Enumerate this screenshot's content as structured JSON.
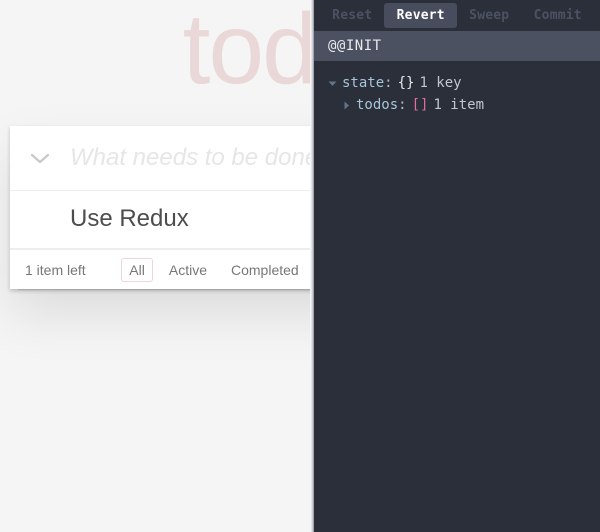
{
  "app": {
    "title": "todos",
    "toggle_all_icon": "chevron-down-icon",
    "new_todo": {
      "value": "",
      "placeholder": "What needs to be done?"
    },
    "items": [
      {
        "label": "Use Redux",
        "completed": false
      }
    ],
    "footer": {
      "count_text": "1 item left",
      "filters": [
        {
          "label": "All",
          "selected": true
        },
        {
          "label": "Active",
          "selected": false
        },
        {
          "label": "Completed",
          "selected": false
        }
      ]
    },
    "colors": {
      "title": "#af2f2f",
      "background": "#f5f5f5",
      "card": "#ffffff",
      "text": "#4d4d4d",
      "placeholder": "#e6e6e6",
      "filter_border": "rgba(175,47,47,0.2)"
    }
  },
  "devtools": {
    "toolbar": {
      "buttons": [
        {
          "label": "Reset",
          "active": false
        },
        {
          "label": "Revert",
          "active": true
        },
        {
          "label": "Sweep",
          "active": false
        },
        {
          "label": "Commit",
          "active": false
        }
      ]
    },
    "actions": [
      {
        "label": "@@INIT",
        "selected": true
      }
    ],
    "state_tree": [
      {
        "level": 0,
        "expanded": true,
        "arrow_icon": "triangle-down-icon",
        "key": "state",
        "colon": ":",
        "brace": "{}",
        "brace_kind": "object",
        "meta": "1 key"
      },
      {
        "level": 1,
        "expanded": false,
        "arrow_icon": "triangle-right-icon",
        "key": "todos",
        "colon": ":",
        "brace": "[]",
        "brace_kind": "array",
        "meta": "1 item"
      }
    ],
    "colors": {
      "panel_background": "#2a2f3a",
      "selected_row": "#4b5161",
      "active_button": "#474d5c",
      "inactive_button_text": "#4c5263",
      "key_text": "#a7c5d8",
      "array_brace": "#e06c9e",
      "meta_text": "#c3c6ce"
    }
  }
}
